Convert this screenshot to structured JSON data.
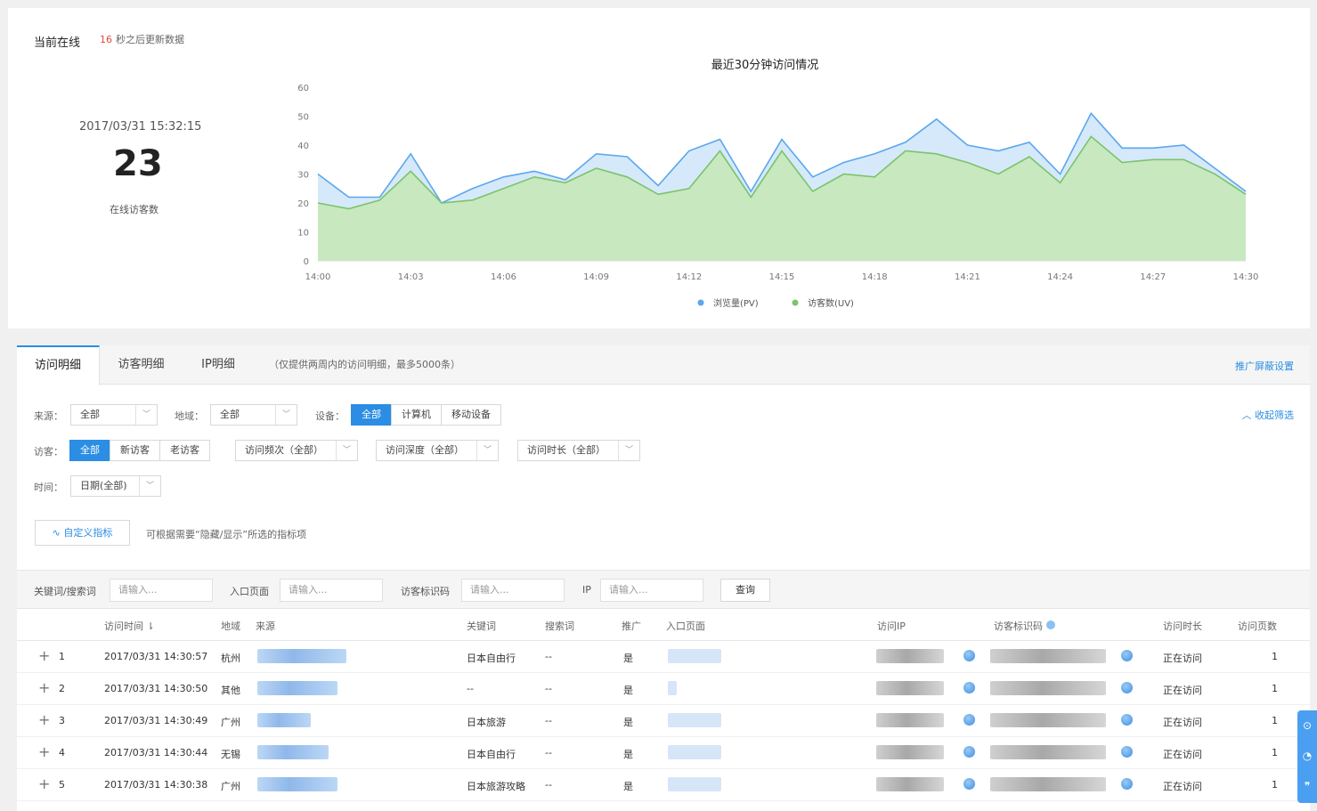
{
  "online": {
    "title": "当前在线",
    "refresh_seconds": "16",
    "refresh_text": "秒之后更新数据",
    "datetime": "2017/03/31 15:32:15",
    "count": "23",
    "count_label": "在线访客数"
  },
  "chart_data": {
    "type": "area",
    "title": "最近30分钟访问情况",
    "x": [
      "14:00",
      "14:01",
      "14:02",
      "14:03",
      "14:04",
      "14:05",
      "14:06",
      "14:07",
      "14:08",
      "14:09",
      "14:10",
      "14:11",
      "14:12",
      "14:13",
      "14:14",
      "14:15",
      "14:16",
      "14:17",
      "14:18",
      "14:19",
      "14:20",
      "14:21",
      "14:22",
      "14:23",
      "14:24",
      "14:25",
      "14:26",
      "14:27",
      "14:28",
      "14:29",
      "14:30"
    ],
    "xticks": [
      "14:00",
      "14:03",
      "14:06",
      "14:09",
      "14:12",
      "14:15",
      "14:18",
      "14:21",
      "14:24",
      "14:27",
      "14:30"
    ],
    "yticks": [
      0,
      10,
      20,
      30,
      40,
      50,
      60
    ],
    "ylim": [
      0,
      60
    ],
    "series": [
      {
        "name": "浏览量(PV)",
        "color": "#5aa7ee",
        "fill": "#d6e9fb",
        "values": [
          30,
          22,
          22,
          37,
          20,
          25,
          29,
          31,
          28,
          37,
          36,
          26,
          38,
          42,
          24,
          42,
          29,
          34,
          37,
          41,
          49,
          40,
          38,
          41,
          30,
          51,
          39,
          39,
          40,
          32,
          24
        ]
      },
      {
        "name": "访客数(UV)",
        "color": "#7cc36b",
        "fill": "#c8e8c0",
        "values": [
          20,
          18,
          21,
          31,
          20,
          21,
          25,
          29,
          27,
          32,
          29,
          23,
          25,
          38,
          22,
          38,
          24,
          30,
          29,
          38,
          37,
          34,
          30,
          36,
          27,
          43,
          34,
          35,
          35,
          30,
          23
        ]
      }
    ]
  },
  "tabs": {
    "items": [
      "访问明细",
      "访客明细",
      "IP明细"
    ],
    "note": "（仅提供两周内的访问明细，最多5000条）",
    "right_link": "推广屏蔽设置"
  },
  "filters": {
    "source_label": "来源：",
    "source_value": "全部",
    "region_label": "地域：",
    "region_value": "全部",
    "device_label": "设备：",
    "device_options": [
      "全部",
      "计算机",
      "移动设备"
    ],
    "visitor_label": "访客：",
    "visitor_options": [
      "全部",
      "新访客",
      "老访客"
    ],
    "freq_value": "访问频次（全部）",
    "depth_value": "访问深度（全部）",
    "duration_value": "访问时长（全部）",
    "time_label": "时间：",
    "time_value": "日期(全部)",
    "collapse": "收起筛选",
    "custom_button": "自定义指标",
    "custom_note": "可根据需要“隐藏/显示”所选的指标项"
  },
  "search": {
    "keyword_label": "关键词/搜索词",
    "entry_label": "入口页面",
    "visitor_id_label": "访客标识码",
    "ip_label": "IP",
    "placeholder": "请输入...",
    "button": "查询"
  },
  "table": {
    "headers": {
      "time": "访问时间",
      "region": "地域",
      "source": "来源",
      "keyword": "关键词",
      "search_word": "搜索词",
      "promo": "推广",
      "entry": "入口页面",
      "ip": "访问IP",
      "visitor_id": "访客标识码",
      "duration": "访问时长",
      "pages": "访问页数"
    },
    "rows": [
      {
        "no": "1",
        "time": "2017/03/31 14:30:57",
        "region": "杭州",
        "keyword": "日本自由行",
        "search_word": "--",
        "promo": "是",
        "duration": "正在访问",
        "pages": "1"
      },
      {
        "no": "2",
        "time": "2017/03/31 14:30:50",
        "region": "其他",
        "keyword": "--",
        "search_word": "--",
        "promo": "是",
        "duration": "正在访问",
        "pages": "1"
      },
      {
        "no": "3",
        "time": "2017/03/31 14:30:49",
        "region": "广州",
        "keyword": "日本旅游",
        "search_word": "--",
        "promo": "是",
        "duration": "正在访问",
        "pages": "1"
      },
      {
        "no": "4",
        "time": "2017/03/31 14:30:44",
        "region": "无锡",
        "keyword": "日本自由行",
        "search_word": "--",
        "promo": "是",
        "duration": "正在访问",
        "pages": "1"
      },
      {
        "no": "5",
        "time": "2017/03/31 14:30:38",
        "region": "广州",
        "keyword": "日本旅游攻略",
        "search_word": "--",
        "promo": "是",
        "duration": "正在访问",
        "pages": "1"
      }
    ]
  }
}
